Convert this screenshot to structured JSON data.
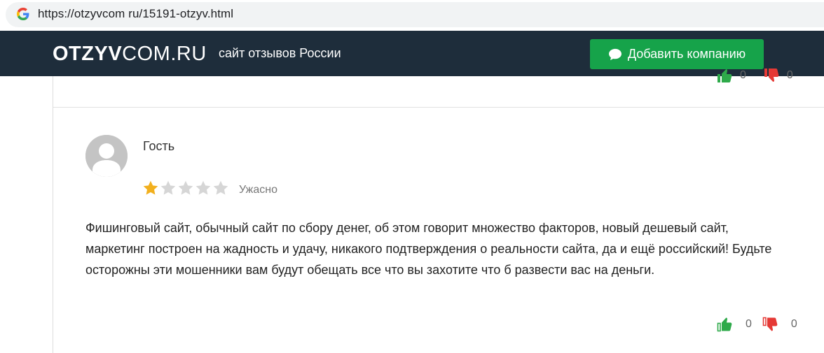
{
  "browser": {
    "url": "https://otzyvcom ru/15191-otzyv.html"
  },
  "header": {
    "logo_bold": "OTZYV",
    "logo_thin": "COM.RU",
    "tagline": "сайт отзывов России",
    "add_company_label": "Добавить компанию",
    "accent_color": "#16a34a",
    "bg_color": "#1e2d3b"
  },
  "previous_review": {
    "likes": "0",
    "dislikes": "0"
  },
  "review": {
    "author": "Гость",
    "rating": 1,
    "rating_max": 5,
    "rating_label": "Ужасно",
    "text": "Фишинговый сайт, обычный сайт по сбору денег, об этом говорит множество факторов, новый дешевый сайт, маркетинг построен на жадность и удачу, никакого подтверждения о реальности сайта, да и ещё российский! Будьте осторожны эти мошенники вам будут обещать все что вы захотите что б развести вас на деньги.",
    "likes": "0",
    "dislikes": "0"
  }
}
